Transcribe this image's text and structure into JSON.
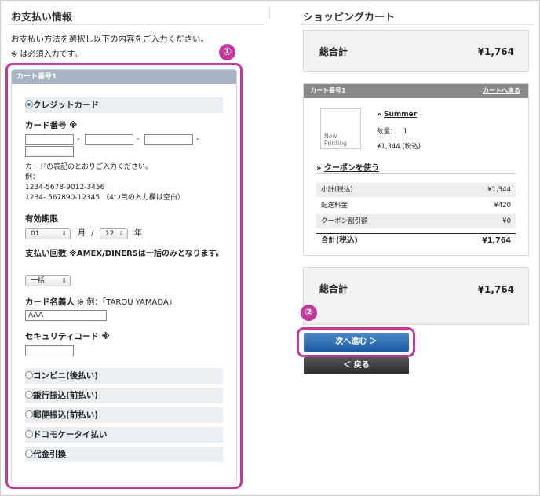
{
  "payment": {
    "title": "お支払い情報",
    "intro": "お支払い方法を選択し以下の内容をご入力ください。",
    "required_note": "※ は必須入力です。",
    "callout_1": "①",
    "tab_label": "カート番号1",
    "credit_card_label": "クレジットカード",
    "card_number_label": "カード番号 ※",
    "card_number_dash": "-",
    "card_number_note": "カードの表記のとおりご入力ください。",
    "example_label": "例：",
    "example_1": "1234-5678-9012-3456",
    "example_2": "1234- 567890-12345 （4つ目の入力欄は空白）",
    "expiry_label": "有効期限",
    "expiry_month": "01",
    "expiry_month_unit": "月",
    "expiry_sep": "/",
    "expiry_year": "12",
    "expiry_year_unit": "年",
    "installment_label": "支払い回数",
    "installment_note": "※AMEX/DINERSは一括のみとなります。",
    "installment_value": "一括",
    "cardholder_label": "カード名義人",
    "cardholder_example": "※ 例：「TAROU YAMADA」",
    "cardholder_value": "AAA",
    "security_label": "セキュリティコード ※",
    "methods": [
      "コンビニ(後払い)",
      "銀行振込(前払い)",
      "郵便振込(前払い)",
      "ドコモケータイ払い",
      "代金引換"
    ]
  },
  "cart": {
    "title": "ショッピングカート",
    "total_label": "総合計",
    "total_value": "¥1,764",
    "cart_header": "カート番号1",
    "back_to_cart": "カートへ戻る",
    "thumb_text_1": "Now",
    "thumb_text_2": "Printing",
    "item_name": "Summer",
    "quantity_label": "数量：",
    "quantity_value": "1",
    "item_price": "¥1,344 (税込)",
    "coupon_link": "クーポンを使う",
    "rows": [
      {
        "label": "小計(税込)",
        "value": "¥1,344"
      },
      {
        "label": "配送料金",
        "value": "¥420"
      },
      {
        "label": "クーポン割引額",
        "value": "¥0"
      }
    ],
    "grand_label": "合計(税込)",
    "grand_value": "¥1,764",
    "callout_2": "②",
    "next_button": "次へ進む ＞",
    "back_button": "＜ 戻る"
  },
  "colors": {
    "accent": "#c2389c",
    "next_button": "#1f5aa0",
    "tab": "#a6b4c3"
  }
}
